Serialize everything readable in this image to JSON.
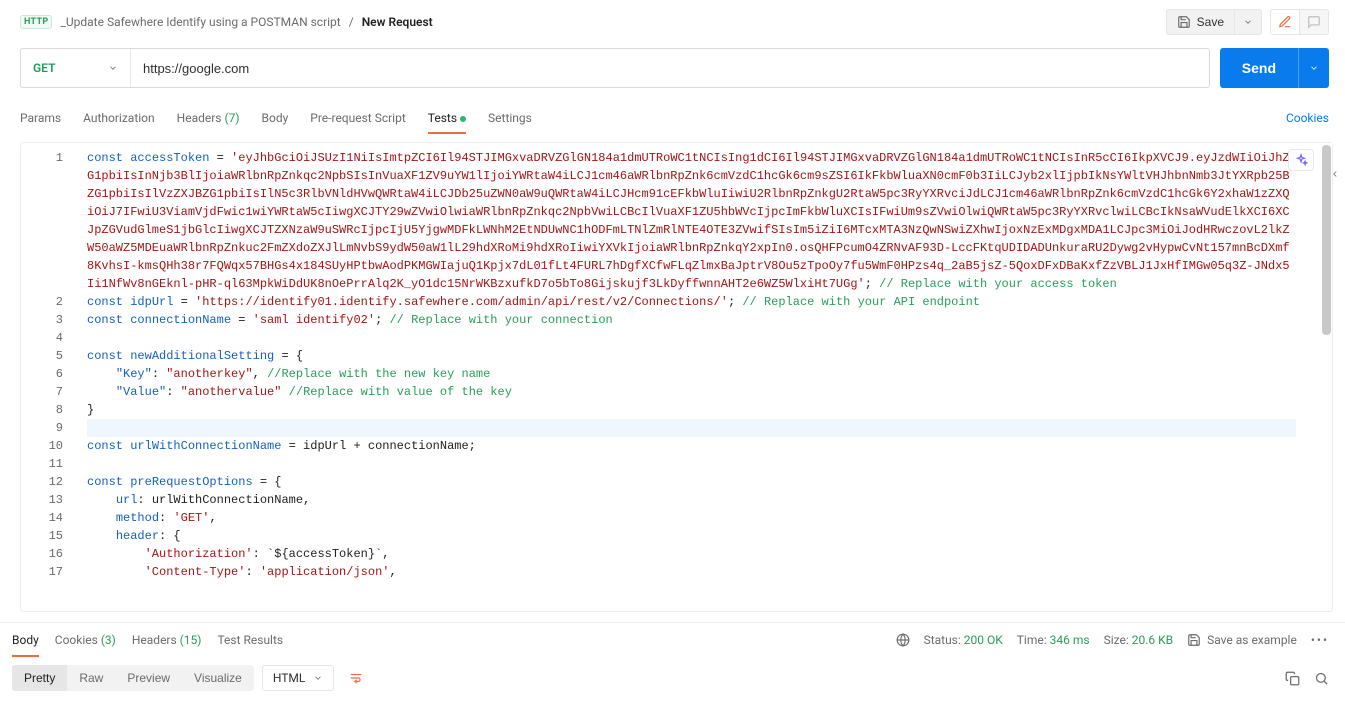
{
  "breadcrumb": {
    "badge": "HTTP",
    "collection": "_Update Safewhere Identify using a POSTMAN script",
    "requestName": "New Request"
  },
  "topbar": {
    "saveLabel": "Save"
  },
  "request": {
    "method": "GET",
    "url": "https://google.com",
    "sendLabel": "Send"
  },
  "tabs": {
    "params": "Params",
    "authorization": "Authorization",
    "headers": "Headers",
    "headersCount": "(7)",
    "body": "Body",
    "prerequest": "Pre-request Script",
    "tests": "Tests",
    "settings": "Settings",
    "cookies": "Cookies"
  },
  "editor": {
    "lineNumbers": [
      "1",
      "2",
      "3",
      "4",
      "5",
      "6",
      "7",
      "8",
      "9",
      "10",
      "11",
      "12",
      "13",
      "14",
      "15",
      "16",
      "17"
    ],
    "token": "eyJhbGciOiJSUzI1NiIsImtpZCI6Il94STJIMGxvaDRVZGlGN184a1dmUTRoWC1tNCIsIng1dCI6Il94STJIMGxvaDRVZGlGN184a1dmUTRoWC1tNCIsInR5cCI6IkpXVCJ9.eyJzdWIiOiJhZG1pbiIsInNjb3BlIjoiaWRlbnRpZnkqc2NpbSIsInVuaXF1ZV9uYW1lIjoiYWRtaW4iLCJ1cm46aWRlbnRpZnk6cmVzdC1hcGk6cm9sZSI6IkFkbWluaXN0cmF0b3IiLCJyb2xlIjpbIkNsYWltVHJhbnNmb3JtYXRpb25BZG1pbiIsIlVzZXJBZG1pbiIsIlN5c3RlbVNldHVwQWRtaW4iLCJDb25uZWN0aW9uQWRtaW4iLCJHcm91cEFkbWluIiwiU2RlbnRpZnkgU2RtaW5pc3RyYXRvciJdLCJ1cm46aWRlbnRpZnk6cmVzdC1hcGk6Y2xhaW1zZXQiOiJ7IFwiU3ViamVjdFwic1wiYWRtaW5cIiwgXCJTY29wZVwiOlwiaWRlbnRpZnkqc2NpbVwiLCBcIlVuaXF1ZU5hbWVcIjpcImFkbWluXCIsIFwiUm9sZVwiOlwiQWRtaW5pc3RyYXRvclwiLCBcIkNsaWVudElkXCI6XCJpZGVudGlmeS1jbGlcIiwgXCJTZXNzaW9uSWRcIjpcIjU5YjgwMDFkLWNhM2EtNDUwNC1hODFmLTNlZmRlNTE4OTE3ZVwifSIsIm5iZiI6MTcxMTA3NzQwNSwiZXhwIjoxNzExMDgxMDA1LCJpc3MiOiJodHRwczovL2lkZW50aWZ5MDEuaWRlbnRpZnkuc2FmZXdoZXJlLmNvbS9ydW50aW1lL29hdXRoMi9hdXRoIiwiYXVkIjoiaWRlbnRpZnkqY2xpIn0.osQHFPcumO4ZRNvAF93D-LccFKtqUDIDADUnkuraRU2Dywg2vHypwCvNt157mnBcDXmf8KvhsI-kmsQHh38r7FQWqx57BHGs4x184SUyHPtbwAodPKMGWIajuQ1Kpjx7dL01fLt4FURL7hDgfXCfwFLqZlmxBaJptrV8Ou5zTpoOy7fu5WmF0HPzs4q_2aB5jsZ-5QoxDFxDBaKxfZzVBLJ1JxHfIMGw05q3Z-JNdx5Ii1NfWv8nGEknl-pHR-ql63MpkWiDdUK8nOePrrAlq2K_yO1dc15NrWKBzxufkD7o5bTo8Gijskujf3LkDyffwnnAHT2e6WZ5WlxiHt7UGg",
    "tokenComment": "// Replace with your access token",
    "idpUrl": "https://identify01.identify.safewhere.com/admin/api/rest/v2/Connections/",
    "idpUrlComment": "// Replace with your API endpoint",
    "connectionName": "saml identify02",
    "connectionComment": "// Replace with your connection",
    "keyName": "anotherkey",
    "keyComment": "//Replace with the new key name",
    "valueName": "anothervalue",
    "valueComment": "//Replace with value of the key",
    "constAccessToken": "const",
    "accessTokenVar": "accessToken",
    "idpUrlVar": "idpUrl",
    "connVar": "connectionName",
    "newAddVar": "newAdditionalSetting",
    "urlWithVar": "urlWithConnectionName",
    "urlWithExpr": " = idpUrl + connectionName;",
    "preReqVar": "preRequestOptions",
    "urlProp": "url",
    "urlPropExpr": ": urlWithConnectionName,",
    "methodProp": "method",
    "methodVal": "GET",
    "headerProp": "header",
    "authProp": "Authorization",
    "authExpr": ": `${accessToken}`,",
    "ctProp": "Content-Type",
    "ctVal": "application/json"
  },
  "response": {
    "tabs": {
      "body": "Body",
      "cookies": "Cookies",
      "cookiesCount": "(3)",
      "headers": "Headers",
      "headersCount": "(15)",
      "testResults": "Test Results"
    },
    "statusLabel": "Status:",
    "statusValue": "200 OK",
    "timeLabel": "Time:",
    "timeValue": "346 ms",
    "sizeLabel": "Size:",
    "sizeValue": "20.6 KB",
    "saveExample": "Save as example"
  },
  "respToolbar": {
    "pretty": "Pretty",
    "raw": "Raw",
    "preview": "Preview",
    "visualize": "Visualize",
    "format": "HTML"
  }
}
